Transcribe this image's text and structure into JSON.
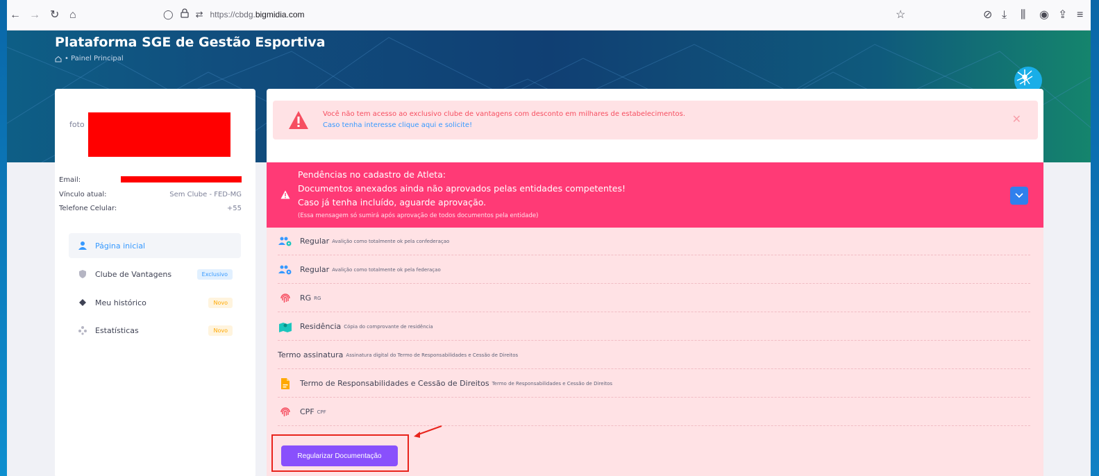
{
  "browser": {
    "url_prefix": "https://cbdg.",
    "url_domain": "bigmidia.com"
  },
  "header": {
    "title": "Plataforma SGE de Gestão Esportiva",
    "breadcrumb": "• Painel Principal"
  },
  "profile": {
    "foto_label": "foto",
    "rows": [
      {
        "label": "Email:",
        "value": ""
      },
      {
        "label": "Vínculo atual:",
        "value": "Sem Clube - FED-MG"
      },
      {
        "label": "Telefone Celular:",
        "value": "+55"
      }
    ]
  },
  "sidebar": {
    "items": [
      {
        "label": "Página inicial",
        "badge": ""
      },
      {
        "label": "Clube de Vantagens",
        "badge": "Exclusivo"
      },
      {
        "label": "Meu histórico",
        "badge": "Novo"
      },
      {
        "label": "Estatísticas",
        "badge": "Novo"
      }
    ]
  },
  "alert_club": {
    "line1": "Você não tem acesso ao exclusivo clube de vantagens com desconto em milhares de estabelecimentos.",
    "line2": "Caso tenha interesse clique aqui e solicite!"
  },
  "alert_pending": {
    "line1": "Pendências no cadastro de Atleta:",
    "line2": "Documentos anexados ainda não aprovados pelas entidades competentes!",
    "line3": "Caso já tenha incluído, aguarde aprovação.",
    "note": "(Essa mensagem só sumirá após aprovação de todos documentos pela entidade)"
  },
  "documents": [
    {
      "name": "Regular",
      "desc": "Avalição como totalmente ok pela confederaçao",
      "icon": "users-cog-icon"
    },
    {
      "name": "Regular",
      "desc": "Avalição como totalmente ok pela federaçao",
      "icon": "users-cog-icon"
    },
    {
      "name": "RG",
      "desc": "RG",
      "icon": "fingerprint-icon"
    },
    {
      "name": "Residência",
      "desc": "Cópia do comprovante de residência",
      "icon": "map-icon"
    },
    {
      "name": "Termo assinatura",
      "desc": "Assinatura digital do Termo de Responsabilidades e Cessão de Direitos",
      "icon": ""
    },
    {
      "name": "Termo de Responsabilidades e Cessão de Direitos",
      "desc": "Termo de Responsabilidades e Cessão de Direitos",
      "icon": "pdf-file-icon"
    },
    {
      "name": "CPF",
      "desc": "CPF",
      "icon": "fingerprint-icon"
    }
  ],
  "actions": {
    "regularize": "Regularizar Documentação"
  }
}
